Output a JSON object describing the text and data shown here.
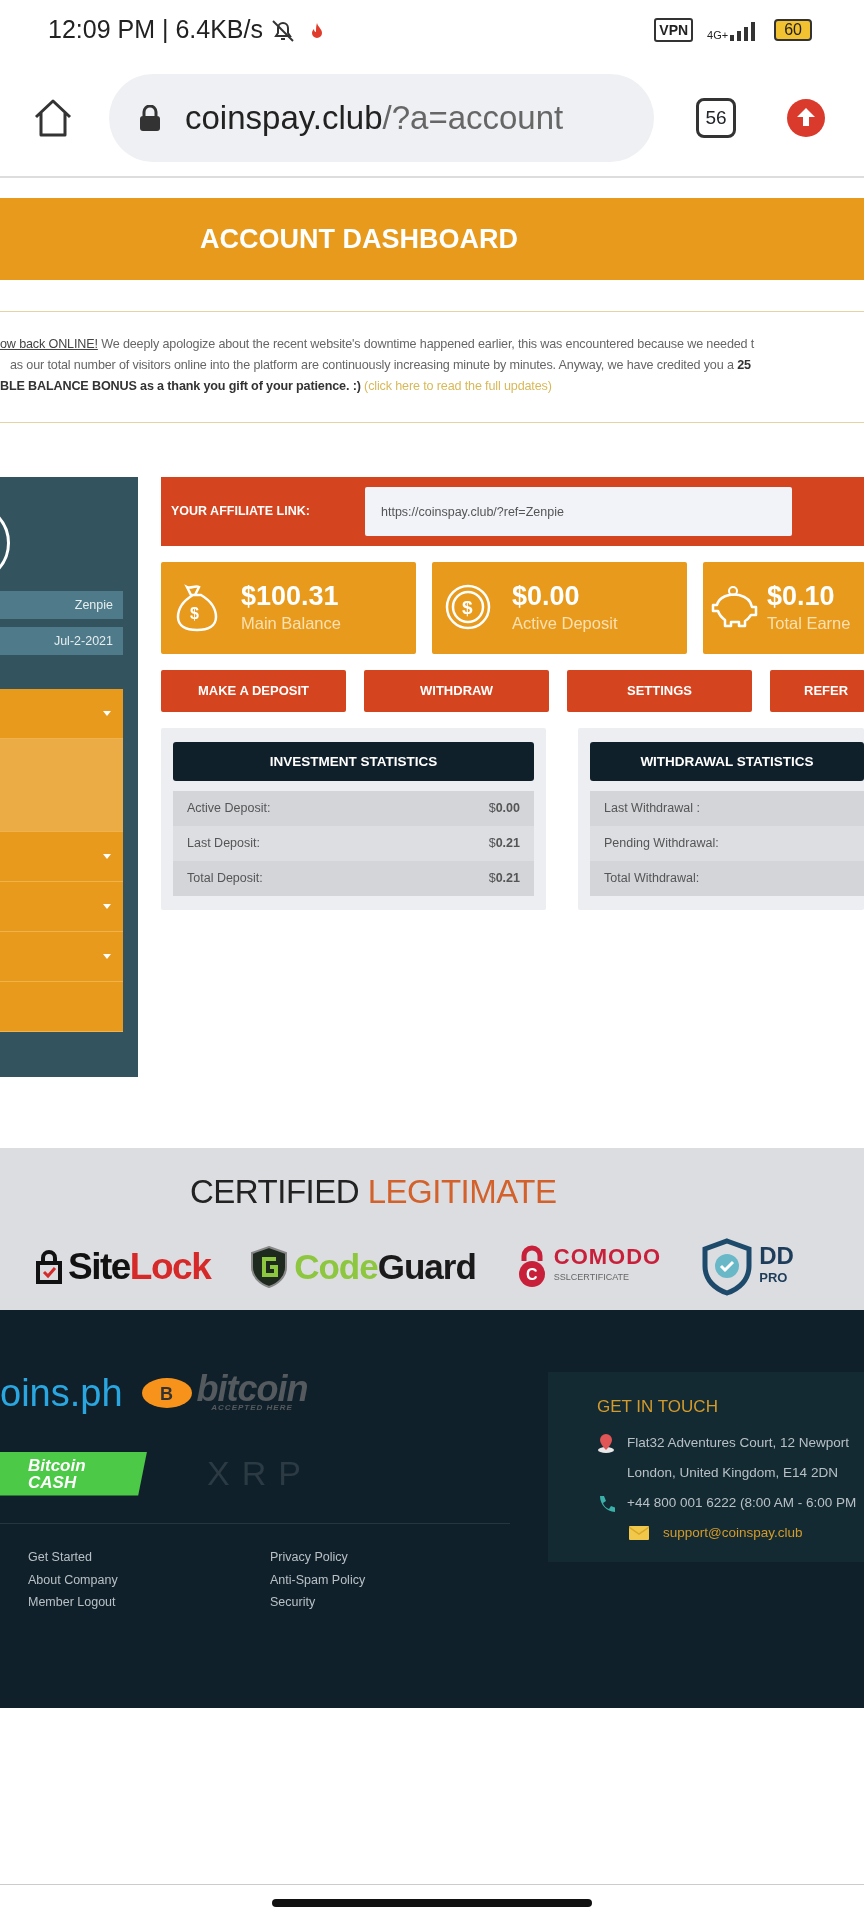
{
  "status_bar": {
    "time": "12:09 PM | 6.4KB/s",
    "vpn": "VPN",
    "network": "4G+",
    "battery": "60"
  },
  "browser": {
    "host": "coinspay.club",
    "path": "/?a=account",
    "tabs_count": "56"
  },
  "banner": {
    "title": "ACCOUNT DASHBOARD"
  },
  "notice": {
    "lines": [
      {
        "link": "ow back ONLINE!",
        "text": " We deeply apologize about the recent website's downtime happened earlier, this was encountered because we needed t"
      },
      {
        "text": "as our total number of visitors online into the platform are continuously increasing minute by minutes. Anyway, we have credited you a **25**"
      },
      {
        "text": "BLE BALANCE BONUS as a thank you gift of your patience. :)",
        "link": "(click here to read the full updates)"
      }
    ]
  },
  "sidebar": {
    "username": "Zenpie",
    "joined": "Jul-2-2021",
    "menu": [
      {
        "kind": "dropdown"
      },
      {
        "kind": "panel"
      },
      {
        "kind": "dropdown"
      },
      {
        "kind": "dropdown"
      },
      {
        "kind": "dropdown"
      },
      {
        "kind": "plain"
      }
    ]
  },
  "affiliate": {
    "label": "YOUR AFFILIATE LINK:",
    "value": "https://coinspay.club/?ref=Zenpie"
  },
  "stats_cards": [
    {
      "kind": "bag",
      "glyph": "$",
      "amount": "$100.31",
      "label": "Main Balance"
    },
    {
      "kind": "coin",
      "glyph": "$",
      "amount": "$0.00",
      "label": "Active Deposit"
    },
    {
      "kind": "piggy",
      "amount": "$0.10",
      "label": "Total Earne"
    }
  ],
  "actions": [
    "MAKE A DEPOSIT",
    "WITHDRAW",
    "SETTINGS",
    "REFER"
  ],
  "panels": [
    {
      "title": "INVESTMENT STATISTICS",
      "rows": [
        {
          "label": "Active Deposit:",
          "value": "$**0.00**"
        },
        {
          "label": "Last Deposit:",
          "value": "$**0.21**"
        },
        {
          "label": "Total Deposit:",
          "value": "$**0.21**"
        }
      ]
    },
    {
      "title": "WITHDRAWAL STATISTICS",
      "rows": [
        {
          "label": "Last Withdrawal :"
        },
        {
          "label": "Pending Withdrawal:"
        },
        {
          "label": "Total Withdrawal:"
        }
      ]
    }
  ],
  "certified": {
    "title": "CERTIFIED",
    "accent": "LEGITIMATE",
    "logos": [
      {
        "kind": "sitelock",
        "text": "Site",
        "accent": "Lock"
      },
      {
        "kind": "codeguard",
        "text": "Guard",
        "accent": "Code"
      },
      {
        "kind": "comodo",
        "glyph": "C",
        "text": "COMODO",
        "sub": "SSLCERTIFICATE"
      },
      {
        "kind": "ddos",
        "text": "DD",
        "sub": "PRO"
      }
    ]
  },
  "footer": {
    "payment_logos": [
      {
        "kind": "coinsph",
        "text": "oins.ph"
      },
      {
        "kind": "bitcoin",
        "glyph": "B",
        "text": "bitcoin",
        "sub": "ACCEPTED HERE"
      },
      {
        "kind": "bch",
        "text": "Bitcoin",
        "sub": "CASH"
      },
      {
        "kind": "xrp",
        "text": "XRP"
      }
    ],
    "links": [
      [
        "Get Started",
        "About Company",
        "Member Logout"
      ],
      [
        "Privacy Policy",
        "Anti-Spam Policy",
        "Security"
      ]
    ],
    "contact": {
      "title": "GET IN TOUCH",
      "address": [
        "Flat32 Adventures Court, 12 Newport",
        "London, United Kingdom, E14 2DN"
      ],
      "phone": "+44 800 001 6222 (8:00 AM - 6:00 PM",
      "email": "support@coinspay.club"
    }
  }
}
